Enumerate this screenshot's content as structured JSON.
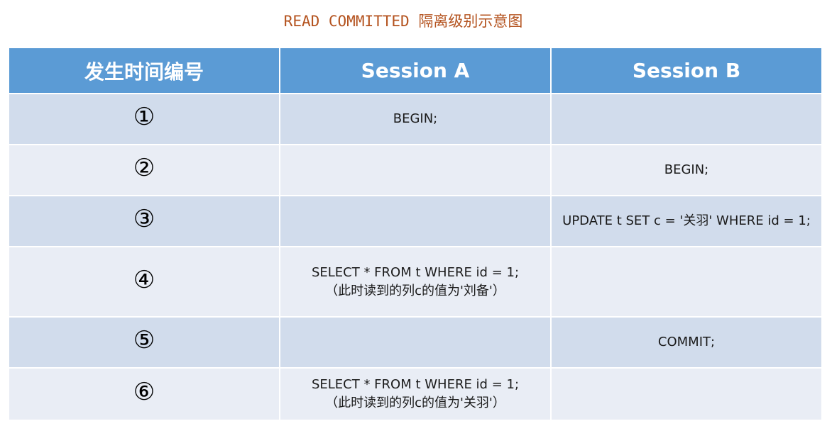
{
  "title": "READ COMMITTED 隔离级别示意图",
  "table": {
    "headers": [
      "发生时间编号",
      "Session A",
      "Session B"
    ],
    "rows": [
      {
        "num": "①",
        "a": [
          "BEGIN;"
        ],
        "b": [
          ""
        ]
      },
      {
        "num": "②",
        "a": [
          ""
        ],
        "b": [
          "BEGIN;"
        ]
      },
      {
        "num": "③",
        "a": [
          ""
        ],
        "b": [
          "UPDATE t SET c = '关羽' WHERE id = 1;"
        ]
      },
      {
        "num": "④",
        "a": [
          "SELECT * FROM t WHERE id = 1;",
          "（此时读到的列c的值为'刘备'）"
        ],
        "b": [
          ""
        ]
      },
      {
        "num": "⑤",
        "a": [
          ""
        ],
        "b": [
          "COMMIT;"
        ]
      },
      {
        "num": "⑥",
        "a": [
          "SELECT * FROM t WHERE id = 1;",
          "（此时读到的列c的值为'关羽'）"
        ],
        "b": [
          ""
        ]
      }
    ]
  },
  "colors": {
    "title": "#b4531f",
    "header_bg": "#5b9bd5",
    "row_dark": "#d1dcec",
    "row_light": "#e9edf5"
  }
}
